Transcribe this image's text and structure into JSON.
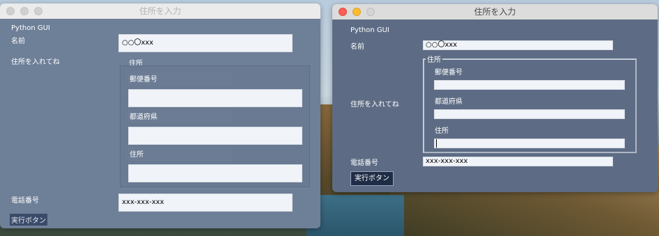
{
  "left_window": {
    "title": "住所を入力",
    "app_label": "Python GUI",
    "name_label": "名前",
    "name_value": "○○〇xxx",
    "address_prompt": "住所を入れてね",
    "address_frame_title": "住所",
    "postal_label": "郵便番号",
    "postal_value": "",
    "prefecture_label": "都道府県",
    "prefecture_value": "",
    "address_label": "住所",
    "address_value": "",
    "phone_label": "電話番号",
    "phone_value": "xxx-xxx-xxx",
    "submit_label": "実行ボタン"
  },
  "right_window": {
    "title": "住所を入力",
    "app_label": "Python GUI",
    "name_label": "名前",
    "name_value": "○○〇xxx",
    "address_prompt": "住所を入れてね",
    "address_frame_title": "住所",
    "postal_label": "郵便番号",
    "postal_value": "",
    "prefecture_label": "都道府県",
    "prefecture_value": "",
    "address_label": "住所",
    "address_value": "",
    "phone_label": "電話番号",
    "phone_value": "xxx-xxx-xxx",
    "submit_label": "実行ボタン"
  },
  "colors": {
    "close": "#fc5f57",
    "minimize": "#fdbc2e",
    "zoom": "#d4d4d4",
    "button_bg": "#1f2c46"
  }
}
